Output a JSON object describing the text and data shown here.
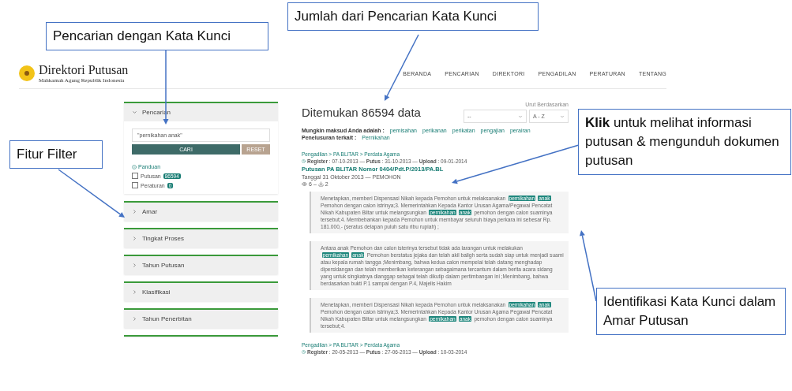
{
  "header": {
    "logo_title": "Direktori Putusan",
    "logo_subtitle": "Mahkamah Agung Republik Indonesia",
    "nav": [
      {
        "label": "BERANDA"
      },
      {
        "label": "PENCARIAN"
      },
      {
        "label": "DIREKTORI"
      },
      {
        "label": "PENGADILAN"
      },
      {
        "label": "PERATURAN"
      },
      {
        "label": "TENTANG"
      }
    ]
  },
  "filter_panel": {
    "search_section": {
      "title": "Pencarian",
      "expanded": true,
      "query": "\"pernikahan anak\"",
      "search_button": "CARI",
      "reset_button": "RESET",
      "guide_link": "Panduan",
      "checkboxes": [
        {
          "label": "Putusan",
          "badge": "86594",
          "checked": false
        },
        {
          "label": "Peraturan",
          "badge": "0",
          "checked": false
        }
      ]
    },
    "sections": [
      {
        "title": "Amar",
        "expanded": false
      },
      {
        "title": "Tingkat Proses",
        "expanded": false
      },
      {
        "title": "Tahun Putusan",
        "expanded": false
      },
      {
        "title": "Klasifikasi",
        "expanded": false
      },
      {
        "title": "Tahun Penerbitan",
        "expanded": false
      }
    ]
  },
  "results": {
    "heading": "Ditemukan 86594 data",
    "sort_label": "Urut Berdasarkan",
    "sort_field": "--",
    "sort_order": "A - Z",
    "suggest_label": "Mungkin maksud Anda adalah :",
    "suggestions": [
      "pemisahan",
      "perikanan",
      "perikatan",
      "pengajian",
      "perairan"
    ],
    "related_label": "Penelusuran terkait :",
    "related": [
      "Pernikahan"
    ],
    "items": [
      {
        "breadcrumb": "Pengadilan > PA BLITAR > Perdata Agama",
        "dates": "**Register** : 07-10-2013 — **Putus** : 31-10-2013 — **Upload** : 09-01-2014",
        "title": "Putusan PA BLITAR Nomor 0404/Pdt.P/2013/PA.BL",
        "subtitle": "Tanggal 31 Oktober 2013 — PEMOHON",
        "views": "6",
        "stat_separator": "–",
        "downloads": "2",
        "snippets": [
          [
            {
              "text": "Menetapkan, memberi Dispensasi Nikah kepada Pemohon untuk melaksanakan ",
              "highlight": false
            },
            {
              "text": "pernikahan",
              "highlight": true
            },
            {
              "text": "anak",
              "highlight": true
            },
            {
              "text": " Pemohon dengan calon istrinya;3. Memerintahkan Kepada Kantor Urusan Agama/Pegawai Pencatat Nikah Kabupaten Blitar untuk melangsungkan ",
              "highlight": false
            },
            {
              "text": "pernikahan",
              "highlight": true
            },
            {
              "text": "anak",
              "highlight": true
            },
            {
              "text": " pemohon dengan calon suaminya tersebut;4. Membebankan kepada Pemohon untuk membayar seluruh biaya perkara ini sebesar Rp. 181.000,- (seratus delapan puluh satu ribu rupiah) ;",
              "highlight": false
            }
          ],
          [
            {
              "text": "Antara anak Pemohon dan calon isterinya tersebut tidak ada larangan untuk melakukan ",
              "highlight": false
            },
            {
              "text": "pernikahan",
              "highlight": true
            },
            {
              "text": "anak",
              "highlight": true
            },
            {
              "text": " Pemohon berstatus jejaka dan telah akil baligh serta sudah siap untuk menjadi suami atau kepala rumah tangga ;Menimbang, bahwa kedua calon mempelai telah datang menghadap dipersidangan dan telah memberikan keterangan sebagaimana tercantum dalam berita acara sidang yang untuk singkatnya dianggap sebagai telah dikutip dalam pertimbangan ini ;Menimbang, bahwa berdasarkan bukti P.1 sampai dengan P.4, Majelis Hakim",
              "highlight": false
            }
          ],
          [
            {
              "text": "Menetapkan, memberi Dispensasi Nikah kepada Pemohon untuk melaksanakan ",
              "highlight": false
            },
            {
              "text": "pernikahan",
              "highlight": true
            },
            {
              "text": "anak",
              "highlight": true
            },
            {
              "text": " Pemohon dengan calon istrinya;3. Memerintahkan Kepada Kantor Urusan Agama Pegawai Pencatat Nikah Kabupaten Blitar untuk melangsungkan ",
              "highlight": false
            },
            {
              "text": "pernikahan",
              "highlight": true
            },
            {
              "text": "anak",
              "highlight": true
            },
            {
              "text": " pemohon dengan calon suaminya tersebut;4.",
              "highlight": false
            }
          ]
        ]
      },
      {
        "breadcrumb": "Pengadilan > PA BLITAR > Perdata Agama",
        "dates": "**Register** : 20-05-2013 — **Putus** : 27-06-2013 — **Upload** : 10-03-2014"
      }
    ]
  },
  "annotations": [
    {
      "text": "Pencarian dengan Kata Kunci"
    },
    {
      "text": "Jumlah dari Pencarian Kata Kunci"
    },
    {
      "text": "Fitur Filter"
    },
    {
      "text": "**Klik** untuk melihat informasi putusan & mengunduh dokumen putusan"
    },
    {
      "text": "Identifikasi Kata Kunci dalam Amar Putusan"
    }
  ]
}
